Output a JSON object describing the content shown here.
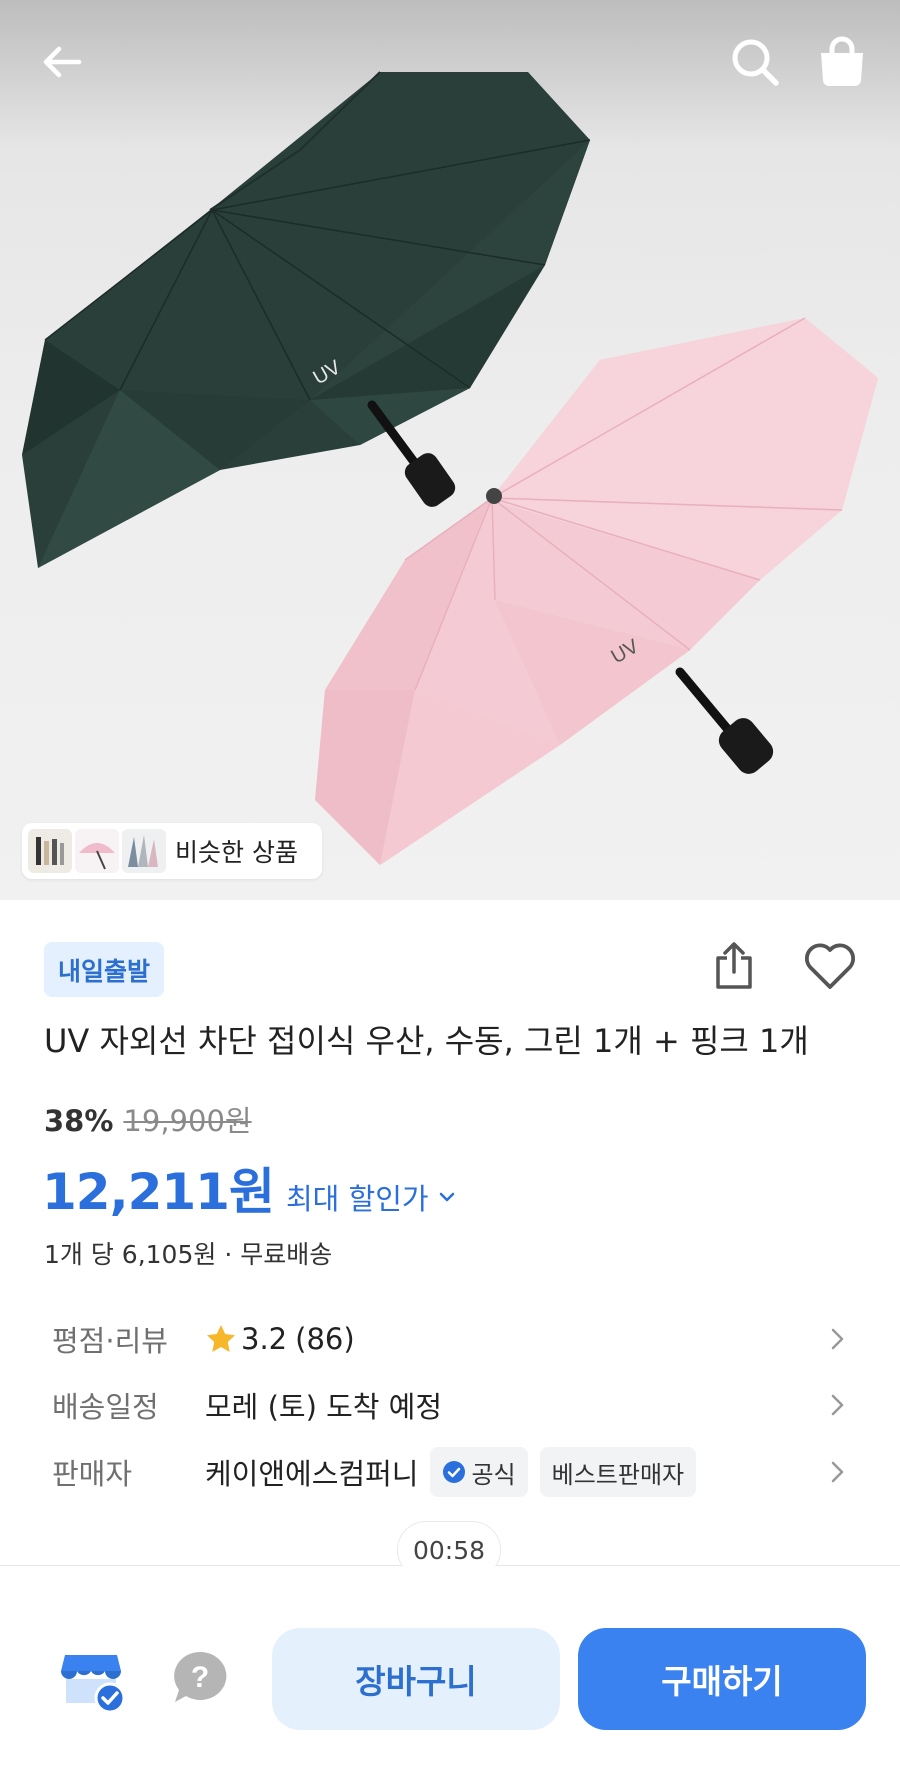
{
  "product_image": {
    "alt": "UV umbrella green and pink",
    "print_text": "UV"
  },
  "similar_products": {
    "label": "비슷한 상품"
  },
  "delivery_badge": "내일출발",
  "product_title": "UV 자외선 차단 접이식 우산, 수동, 그린 1개 + 핑크 1개",
  "pricing": {
    "discount_percent": "38%",
    "original_price": "19,900원",
    "sale_price": "12,211원",
    "max_discount_label": "최대 할인가",
    "unit_info": "1개 당 6,105원 · 무료배송"
  },
  "info_rows": {
    "rating": {
      "label": "평점·리뷰",
      "score": "3.2",
      "count": "(86)"
    },
    "delivery": {
      "label": "배송일정",
      "value": "모레 (토) 도착 예정"
    },
    "seller": {
      "label": "판매자",
      "value": "케이앤에스컴퍼니",
      "official_tag": "공식",
      "best_tag": "베스트판매자"
    }
  },
  "timer": "00:58",
  "bottom_bar": {
    "cart_label": "장바구니",
    "buy_label": "구매하기"
  },
  "colors": {
    "accent": "#2a6fdb",
    "button_primary": "#3a82f0",
    "button_secondary_bg": "#e5f0fd",
    "star": "#f7b72b"
  },
  "icons": [
    "back-arrow-icon",
    "search-icon",
    "shopping-bag-icon",
    "share-icon",
    "heart-icon",
    "star-icon",
    "chevron-right-icon",
    "verified-check-icon",
    "store-icon",
    "question-icon"
  ]
}
